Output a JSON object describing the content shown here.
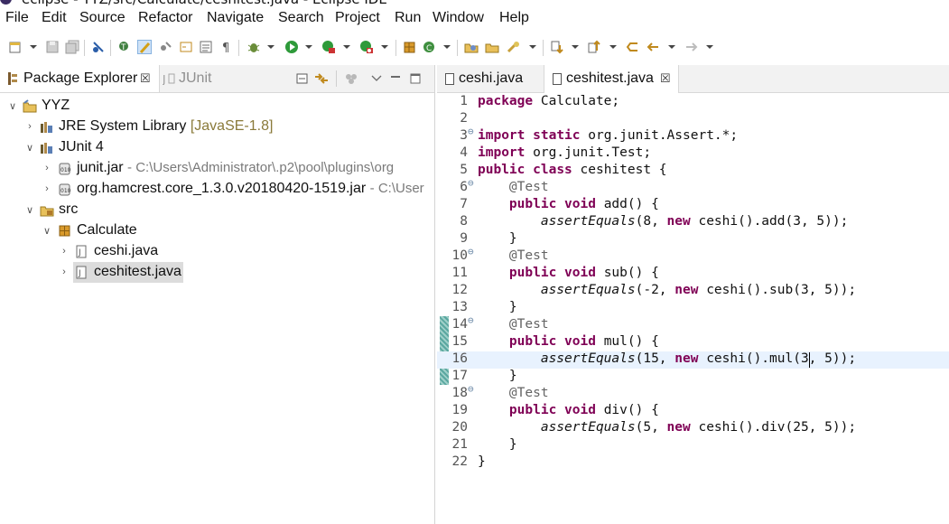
{
  "window": {
    "title": "eclipse - YYZ/src/Calculate/ceshitest.java - Eclipse IDE"
  },
  "menu": [
    "File",
    "Edit",
    "Source",
    "Refactor",
    "Navigate",
    "Search",
    "Project",
    "Run",
    "Window",
    "Help"
  ],
  "left_view": {
    "tabs": [
      {
        "label": "Package Explorer",
        "close": "☒",
        "active": true
      },
      {
        "label": "JUnit",
        "active": false
      }
    ],
    "tree": [
      {
        "label": "YYZ",
        "decoration": "",
        "icon": "project-folder-icon",
        "expanded": true,
        "depth": 0
      },
      {
        "label": "JRE System Library",
        "decoration": "[JavaSE-1.8]",
        "icon": "library-icon",
        "expanded": false,
        "depth": 1
      },
      {
        "label": "JUnit 4",
        "decoration": "",
        "icon": "library-icon",
        "expanded": true,
        "depth": 1
      },
      {
        "label": "junit.jar",
        "decoration": "- C:\\Users\\Administrator\\.p2\\pool\\plugins\\org",
        "icon": "jar-icon",
        "expanded": false,
        "depth": 2
      },
      {
        "label": "org.hamcrest.core_1.3.0.v20180420-1519.jar",
        "decoration": "- C:\\User",
        "icon": "jar-icon",
        "expanded": false,
        "depth": 2
      },
      {
        "label": "src",
        "decoration": "",
        "icon": "source-folder-icon",
        "expanded": true,
        "depth": 1
      },
      {
        "label": "Calculate",
        "decoration": "",
        "icon": "package-icon",
        "expanded": true,
        "depth": 2
      },
      {
        "label": "ceshi.java",
        "decoration": "",
        "icon": "java-file-icon",
        "expanded": false,
        "depth": 3
      },
      {
        "label": "ceshitest.java",
        "decoration": "",
        "icon": "java-file-icon",
        "expanded": false,
        "depth": 3,
        "selected": true
      }
    ]
  },
  "editor": {
    "tabs": [
      {
        "label": "ceshi.java",
        "active": false
      },
      {
        "label": "ceshitest.java",
        "close": "☒",
        "active": true
      }
    ],
    "current_line": 16,
    "lines": [
      {
        "n": "1",
        "fold": "",
        "tokens": [
          {
            "t": "package",
            "c": "kw"
          },
          {
            "t": " Calculate;",
            "c": ""
          }
        ]
      },
      {
        "n": "2",
        "fold": "",
        "tokens": []
      },
      {
        "n": "3",
        "fold": "⊖",
        "tokens": [
          {
            "t": "import",
            "c": "kw"
          },
          {
            "t": " ",
            "c": ""
          },
          {
            "t": "static",
            "c": "kw"
          },
          {
            "t": " org.junit.Assert.*;",
            "c": ""
          }
        ]
      },
      {
        "n": "4",
        "fold": "",
        "tokens": [
          {
            "t": "import",
            "c": "kw"
          },
          {
            "t": " org.junit.Test;",
            "c": ""
          }
        ]
      },
      {
        "n": "5",
        "fold": "",
        "tokens": [
          {
            "t": "public",
            "c": "kw"
          },
          {
            "t": " ",
            "c": ""
          },
          {
            "t": "class",
            "c": "kw"
          },
          {
            "t": " ceshitest {",
            "c": ""
          }
        ]
      },
      {
        "n": "6",
        "fold": "⊖",
        "tokens": [
          {
            "t": "    ",
            "c": ""
          },
          {
            "t": "@Test",
            "c": "ann"
          }
        ]
      },
      {
        "n": "7",
        "fold": "",
        "tokens": [
          {
            "t": "    ",
            "c": ""
          },
          {
            "t": "public",
            "c": "kw"
          },
          {
            "t": " ",
            "c": ""
          },
          {
            "t": "void",
            "c": "kw"
          },
          {
            "t": " add() {",
            "c": ""
          }
        ]
      },
      {
        "n": "8",
        "fold": "",
        "tokens": [
          {
            "t": "        ",
            "c": ""
          },
          {
            "t": "assertEquals",
            "c": "ital"
          },
          {
            "t": "(8, ",
            "c": ""
          },
          {
            "t": "new",
            "c": "kw"
          },
          {
            "t": " ceshi().add(3, 5));",
            "c": ""
          }
        ]
      },
      {
        "n": "9",
        "fold": "",
        "tokens": [
          {
            "t": "    }",
            "c": ""
          }
        ]
      },
      {
        "n": "10",
        "fold": "⊖",
        "tokens": [
          {
            "t": "    ",
            "c": ""
          },
          {
            "t": "@Test",
            "c": "ann"
          }
        ]
      },
      {
        "n": "11",
        "fold": "",
        "tokens": [
          {
            "t": "    ",
            "c": ""
          },
          {
            "t": "public",
            "c": "kw"
          },
          {
            "t": " ",
            "c": ""
          },
          {
            "t": "void",
            "c": "kw"
          },
          {
            "t": " sub() {",
            "c": ""
          }
        ]
      },
      {
        "n": "12",
        "fold": "",
        "tokens": [
          {
            "t": "        ",
            "c": ""
          },
          {
            "t": "assertEquals",
            "c": "ital"
          },
          {
            "t": "(-2, ",
            "c": ""
          },
          {
            "t": "new",
            "c": "kw"
          },
          {
            "t": " ceshi().sub(3, 5));",
            "c": ""
          }
        ]
      },
      {
        "n": "13",
        "fold": "",
        "tokens": [
          {
            "t": "    }",
            "c": ""
          }
        ]
      },
      {
        "n": "14",
        "fold": "⊖",
        "tokens": [
          {
            "t": "    ",
            "c": ""
          },
          {
            "t": "@Test",
            "c": "ann"
          }
        ]
      },
      {
        "n": "15",
        "fold": "",
        "tokens": [
          {
            "t": "    ",
            "c": ""
          },
          {
            "t": "public",
            "c": "kw"
          },
          {
            "t": " ",
            "c": ""
          },
          {
            "t": "void",
            "c": "kw"
          },
          {
            "t": " mul() {",
            "c": ""
          }
        ]
      },
      {
        "n": "16",
        "fold": "",
        "tokens": [
          {
            "t": "        ",
            "c": ""
          },
          {
            "t": "assertEquals",
            "c": "ital"
          },
          {
            "t": "(15, ",
            "c": ""
          },
          {
            "t": "new",
            "c": "kw"
          },
          {
            "t": " ceshi().mul(3, 5));",
            "c": ""
          }
        ]
      },
      {
        "n": "17",
        "fold": "",
        "tokens": [
          {
            "t": "    }",
            "c": ""
          }
        ]
      },
      {
        "n": "18",
        "fold": "⊖",
        "tokens": [
          {
            "t": "    ",
            "c": ""
          },
          {
            "t": "@Test",
            "c": "ann"
          }
        ]
      },
      {
        "n": "19",
        "fold": "",
        "tokens": [
          {
            "t": "    ",
            "c": ""
          },
          {
            "t": "public",
            "c": "kw"
          },
          {
            "t": " ",
            "c": ""
          },
          {
            "t": "void",
            "c": "kw"
          },
          {
            "t": " div() {",
            "c": ""
          }
        ]
      },
      {
        "n": "20",
        "fold": "",
        "tokens": [
          {
            "t": "        ",
            "c": ""
          },
          {
            "t": "assertEquals",
            "c": "ital"
          },
          {
            "t": "(5, ",
            "c": ""
          },
          {
            "t": "new",
            "c": "kw"
          },
          {
            "t": " ceshi().div(25, 5));",
            "c": ""
          }
        ]
      },
      {
        "n": "21",
        "fold": "",
        "tokens": [
          {
            "t": "    }",
            "c": ""
          }
        ]
      },
      {
        "n": "22",
        "fold": "",
        "tokens": [
          {
            "t": "}",
            "c": ""
          }
        ]
      }
    ]
  },
  "colors": {
    "keyword": "#7f0055",
    "annotation": "#646464",
    "selection": "#dcdcdc",
    "current_line": "#e8f2fe"
  }
}
